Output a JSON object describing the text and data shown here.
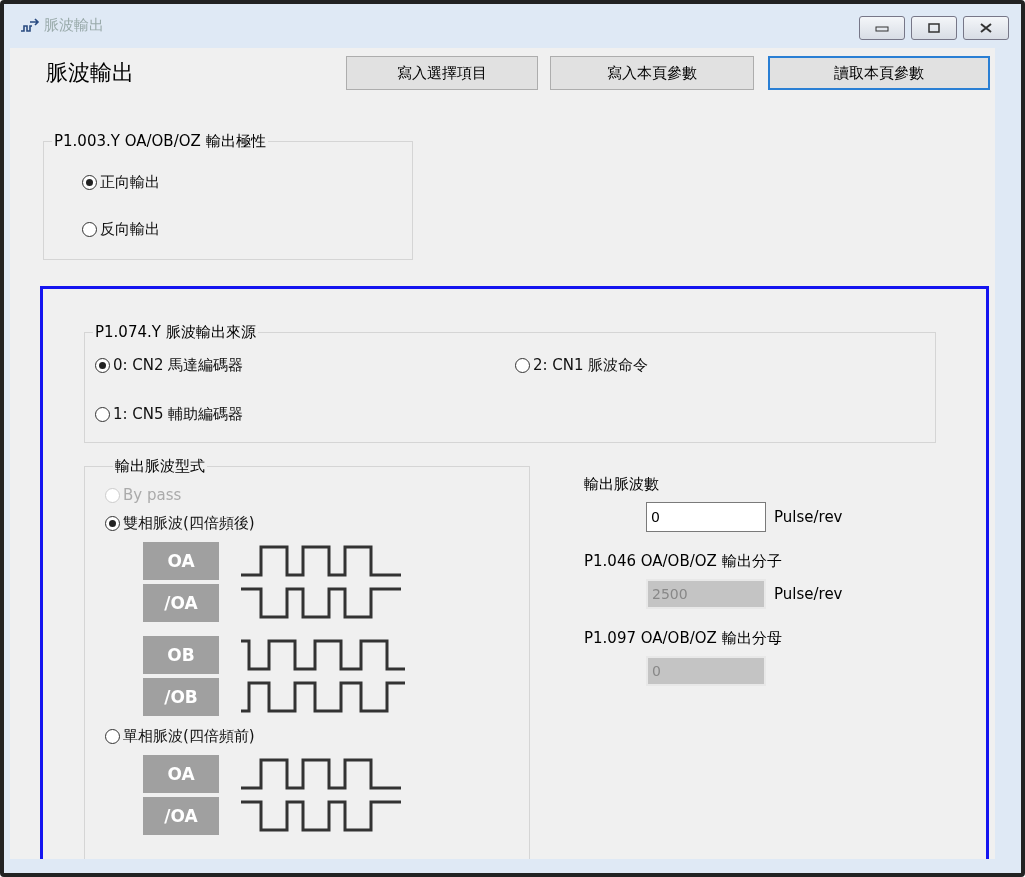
{
  "window": {
    "title": "脈波輸出"
  },
  "page_title": "脈波輸出",
  "buttons": [
    {
      "label": "寫入選擇項目",
      "focused": false
    },
    {
      "label": "寫入本頁參數",
      "focused": false
    },
    {
      "label": "讀取本頁參數",
      "focused": true
    }
  ],
  "polarity": {
    "title": "P1.003.Y OA/OB/OZ 輸出極性",
    "options": [
      {
        "label": "正向輸出",
        "selected": true
      },
      {
        "label": "反向輸出",
        "selected": false
      }
    ]
  },
  "source": {
    "title": "P1.074.Y 脈波輸出來源",
    "options": [
      {
        "label": "0: CN2 馬達編碼器",
        "selected": true
      },
      {
        "label": "2: CN1 脈波命令",
        "selected": false
      },
      {
        "label": "1: CN5 輔助編碼器",
        "selected": false
      }
    ]
  },
  "format": {
    "title": "輸出脈波型式",
    "options": [
      {
        "label": "By pass",
        "selected": false,
        "disabled": true
      },
      {
        "label": "雙相脈波(四倍頻後)",
        "selected": true,
        "disabled": false,
        "signals": [
          {
            "label": "OA",
            "kind": "a"
          },
          {
            "label": "/OA",
            "kind": "a-inv"
          },
          {
            "label": "OB",
            "kind": "b"
          },
          {
            "label": "/OB",
            "kind": "b-inv"
          }
        ]
      },
      {
        "label": "單相脈波(四倍頻前)",
        "selected": false,
        "disabled": false,
        "signals": [
          {
            "label": "OA",
            "kind": "a"
          },
          {
            "label": "/OA",
            "kind": "a-inv"
          }
        ]
      }
    ]
  },
  "fields": [
    {
      "label": "輸出脈波數",
      "value": "0",
      "unit": "Pulse/rev",
      "disabled": false
    },
    {
      "label": "P1.046 OA/OB/OZ 輸出分子",
      "value": "2500",
      "unit": "Pulse/rev",
      "disabled": true
    },
    {
      "label": "P1.097 OA/OB/OZ 輸出分母",
      "value": "0",
      "disabled": true
    }
  ]
}
